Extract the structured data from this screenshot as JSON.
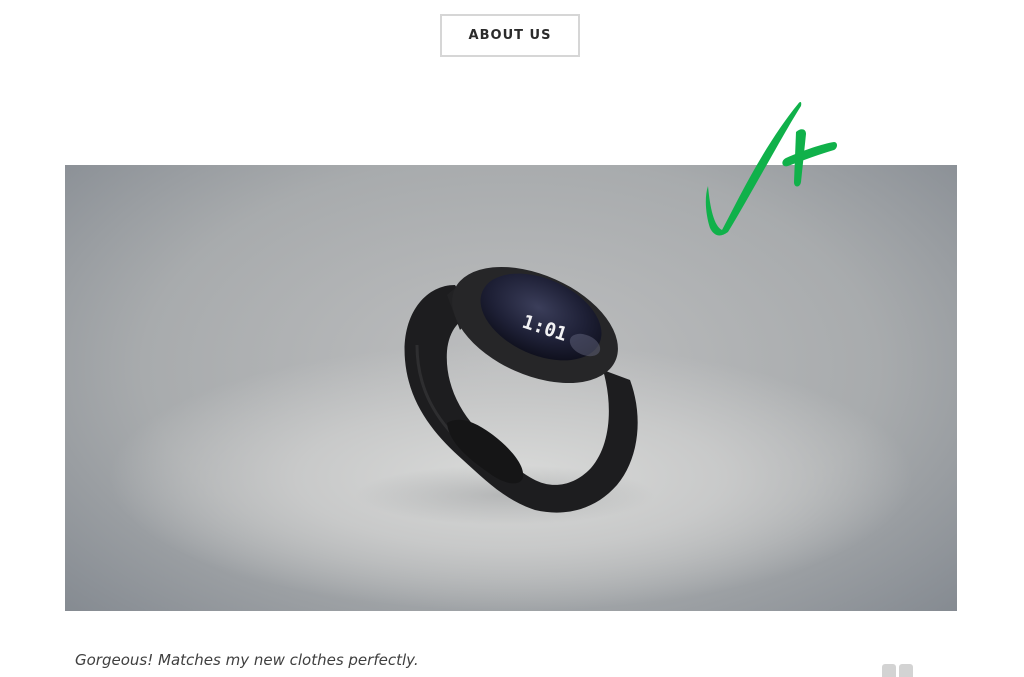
{
  "header": {
    "about_button_label": "ABOUT US"
  },
  "brand": {
    "logo_icon": "checkmark-plus-icon",
    "logo_color": "#10b14a"
  },
  "hero": {
    "product_icon": "smartwatch",
    "watch_time": "1:01"
  },
  "testimonial": {
    "text": "Gorgeous! Matches my new clothes perfectly.",
    "quote_icon": "quote-icon"
  }
}
